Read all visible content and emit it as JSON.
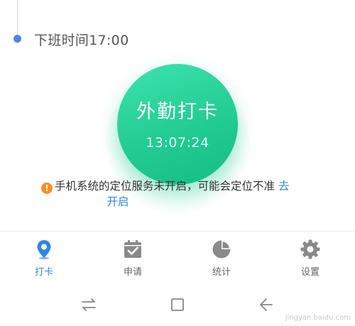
{
  "timeline": {
    "off_work_text": "下班时间17:00"
  },
  "punch": {
    "label": "外勤打卡",
    "time": "13:07:24"
  },
  "warning": {
    "text": "手机系统的定位服务未开启，可能会定位不准",
    "link_part1": "去",
    "link_part2": "开启"
  },
  "tabs": [
    {
      "label": "打卡",
      "icon": "location-pin-icon",
      "active": true
    },
    {
      "label": "申请",
      "icon": "calendar-check-icon",
      "active": false
    },
    {
      "label": "统计",
      "icon": "pie-chart-icon",
      "active": false
    },
    {
      "label": "设置",
      "icon": "gear-icon",
      "active": false
    }
  ],
  "colors": {
    "accent": "#2f86e8",
    "punch_green": "#22cc92",
    "warning": "#ff8c2a",
    "icon_gray": "#8a8a8a"
  },
  "watermark": "jingyan.baidu.com"
}
